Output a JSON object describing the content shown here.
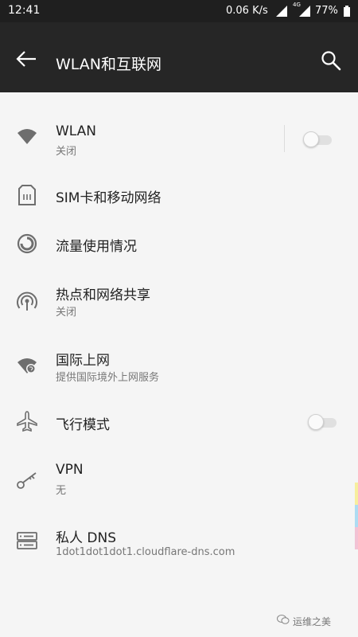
{
  "status_bar": {
    "time": "12:41",
    "speed": "0.06 K/s",
    "network_badge": "4G",
    "battery": "77%"
  },
  "app_bar": {
    "title": "WLAN和互联网"
  },
  "items": [
    {
      "icon": "wifi-icon",
      "title": "WLAN",
      "subtitle": "关闭",
      "toggle": false
    },
    {
      "icon": "sim-card-icon",
      "title": "SIM卡和移动网络"
    },
    {
      "icon": "data-usage-icon",
      "title": "流量使用情况"
    },
    {
      "icon": "hotspot-icon",
      "title": "热点和网络共享",
      "subtitle": "关闭"
    },
    {
      "icon": "global-network-icon",
      "title": "国际上网",
      "subtitle": "提供国际境外上网服务"
    },
    {
      "icon": "airplane-icon",
      "title": "飞行模式",
      "toggle": false
    },
    {
      "icon": "key-icon",
      "title": "VPN",
      "subtitle": "无"
    },
    {
      "icon": "dns-server-icon",
      "title": "私人 DNS",
      "subtitle": "1dot1dot1dot1.cloudflare-dns.com"
    }
  ],
  "watermark": "运维之美",
  "colors": {
    "status_bar_bg": "#1f1f1f",
    "app_bar_bg": "#262626",
    "page_bg": "#f5f5f5",
    "icon_gray": "#6e6e6e",
    "edge_strip": [
      "#f7ee9e",
      "#aedcf2",
      "#f2c2d4"
    ]
  }
}
